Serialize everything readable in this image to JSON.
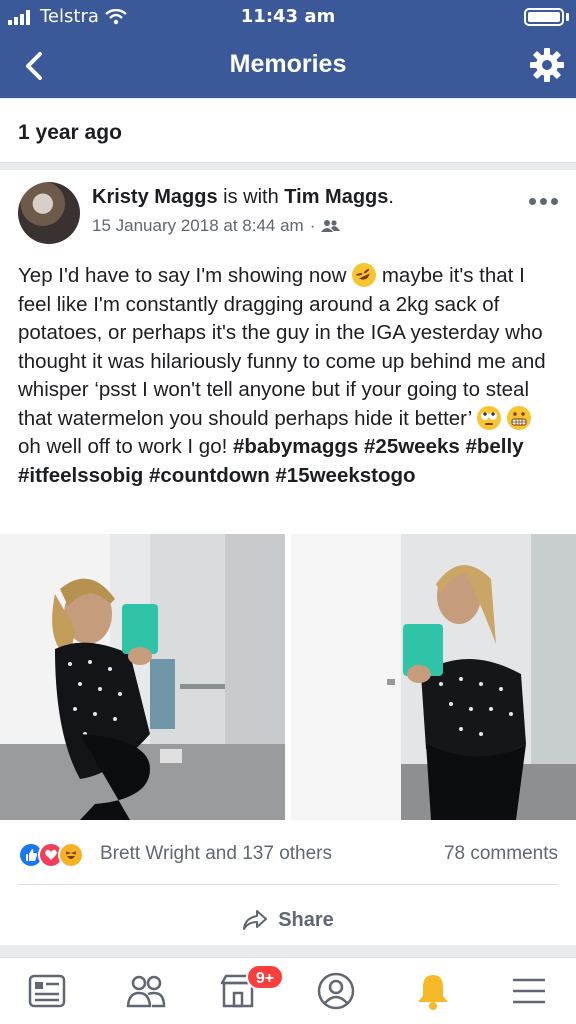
{
  "status_bar": {
    "carrier": "Telstra",
    "time": "11:43 am"
  },
  "nav": {
    "title": "Memories"
  },
  "section": {
    "header": "1 year ago"
  },
  "post": {
    "author": "Kristy Maggs",
    "with_text": "is with",
    "tagged": "Tim Maggs",
    "tagged_suffix": ".",
    "date": "15 January 2018 at 8:44 am",
    "date_sep": "·",
    "text_line1": "Yep I'd have to say I'm showing now",
    "text_line1b": "maybe it's that I feel like I'm constantly dragging around a 2kg sack of potatoes, or perhaps it's the guy in the IGA yesterday who thought it was hilariously funny to come up behind me and whisper ‘psst I won't tell anyone but if your going to steal that watermelon you should perhaps hide it better’",
    "text_line2": "oh well off to work I go!",
    "hashtags": "#babymaggs #25weeks #belly #itfeelssobig #countdown #15weekstogo"
  },
  "reactions": {
    "names": "Brett Wright and 137 others",
    "comments": "78 comments"
  },
  "actions": {
    "share": "Share"
  },
  "tabbar": {
    "badge": "9+"
  },
  "colors": {
    "brand": "#3b5998",
    "like": "#1877f2",
    "love": "#f33e58",
    "haha": "#f7b125",
    "badge": "#fa3e3e"
  }
}
